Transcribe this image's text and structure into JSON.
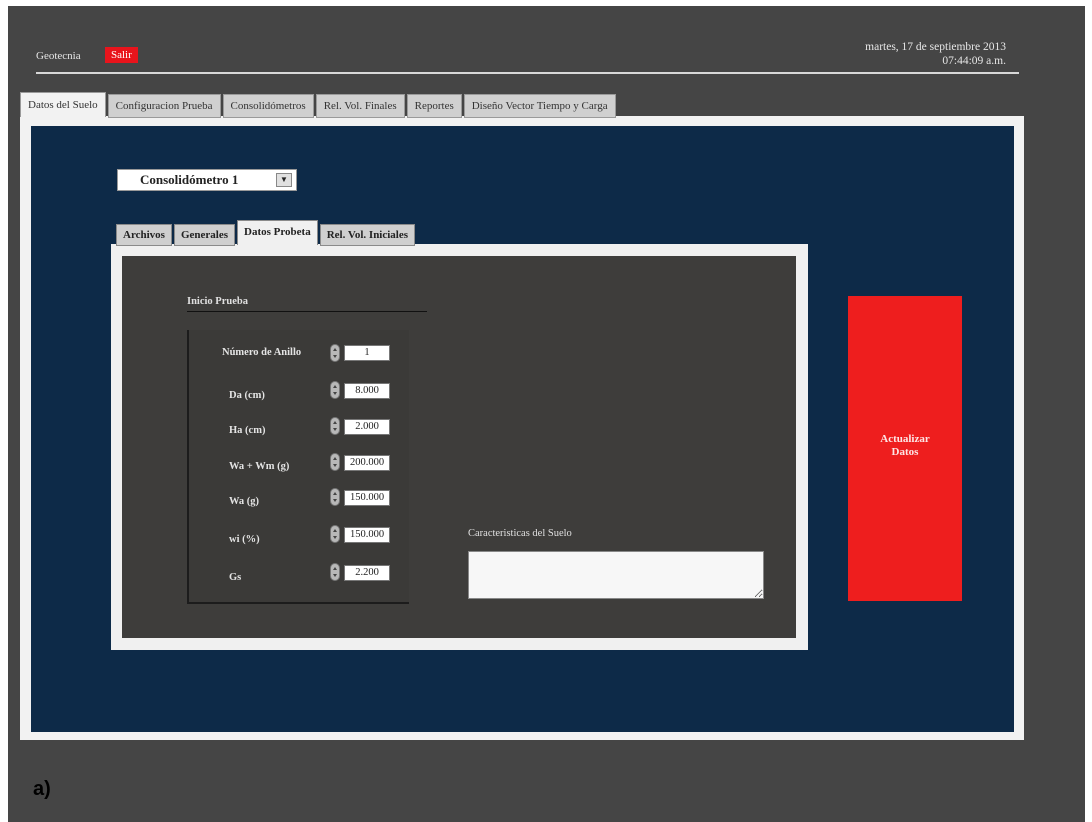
{
  "header": {
    "app_name": "Geotecnia",
    "exit_label": "Salir",
    "date": "martes, 17 de septiembre  2013",
    "time": "07:44:09 a.m."
  },
  "main_tabs": [
    {
      "label": "Datos del Suelo",
      "active": true
    },
    {
      "label": "Configuracion Prueba"
    },
    {
      "label": "Consolidómetros"
    },
    {
      "label": "Rel. Vol. Finales"
    },
    {
      "label": "Reportes"
    },
    {
      "label": "Diseño Vector Tiempo y Carga"
    }
  ],
  "consolidometer_select": {
    "value": "Consolidómetro 1",
    "arrow_icon": "dropdown-arrow-icon"
  },
  "sub_tabs": [
    {
      "label": "Archivos"
    },
    {
      "label": "Generales"
    },
    {
      "label": "Datos Probeta",
      "active": true
    },
    {
      "label": "Rel. Vol. Iniciales"
    }
  ],
  "inicio_prueba": {
    "title": "Inicio Prueba",
    "fields": [
      {
        "label": "Número de Anillo",
        "value": "1"
      },
      {
        "label": "Da (cm)",
        "value": "8.000"
      },
      {
        "label": "Ha (cm)",
        "value": "2.000"
      },
      {
        "label": "Wa + Wm (g)",
        "value": "200.000"
      },
      {
        "label": "Wa (g)",
        "value": "150.000"
      },
      {
        "label": "wi (%)",
        "value": "150.000"
      },
      {
        "label": "Gs",
        "value": "2.200"
      }
    ]
  },
  "caracteristicas": {
    "label": "Caracteristicas del Suelo",
    "value": ""
  },
  "update_button": {
    "line1": "Actualizar",
    "line2": "Datos"
  },
  "figure_label": "a)",
  "colors": {
    "navy": "#0d2a48",
    "accent_red": "#ee1e1e",
    "frame": "#454545"
  }
}
